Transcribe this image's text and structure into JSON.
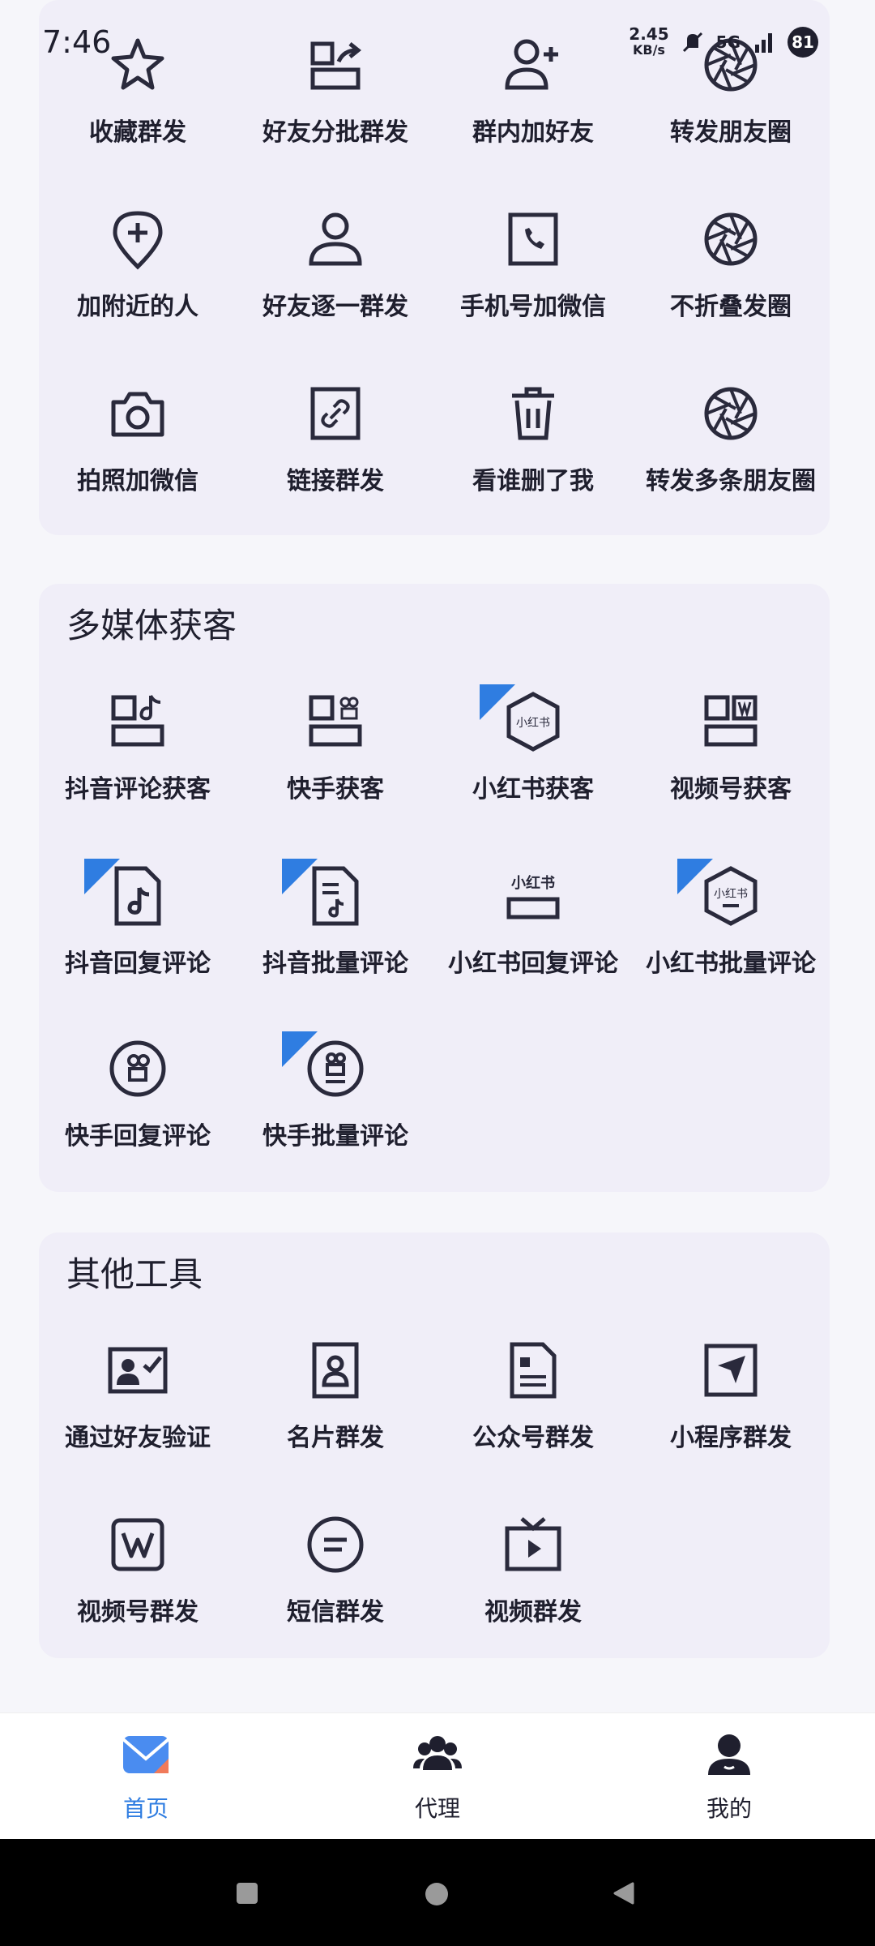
{
  "status": {
    "time": "7:46",
    "speed_value": "2.45",
    "speed_unit": "KB/s",
    "network": "5G",
    "battery": "81"
  },
  "sections": {
    "top": {
      "items": [
        "收藏群发",
        "好友分批群发",
        "群内加好友",
        "转发朋友圈",
        "加附近的人",
        "好友逐一群发",
        "手机号加微信",
        "不折叠发圈",
        "拍照加微信",
        "链接群发",
        "看谁删了我",
        "转发多条朋友圈"
      ]
    },
    "media": {
      "title": "多媒体获客",
      "items": [
        "抖音评论获客",
        "快手获客",
        "小红书获客",
        "视频号获客",
        "抖音回复评论",
        "抖音批量评论",
        "小红书回复评论",
        "小红书批量评论",
        "快手回复评论",
        "快手批量评论"
      ],
      "logo_text": "小红书"
    },
    "other": {
      "title": "其他工具",
      "items": [
        "通过好友验证",
        "名片群发",
        "公众号群发",
        "小程序群发",
        "视频号群发",
        "短信群发",
        "视频群发"
      ]
    }
  },
  "nav": {
    "home": "首页",
    "agent": "代理",
    "mine": "我的"
  },
  "colors": {
    "accent": "#2f7de1",
    "icon": "#2a2a3c",
    "card_bg": "#f0eef8"
  }
}
